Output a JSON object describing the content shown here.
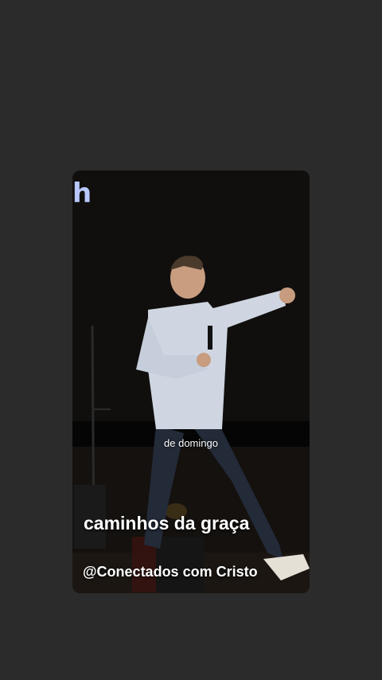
{
  "story": {
    "logo_text": "h",
    "subtitle": "de domingo",
    "caption_title": "caminhos da graça",
    "caption_handle": "@Conectados com Cristo"
  }
}
